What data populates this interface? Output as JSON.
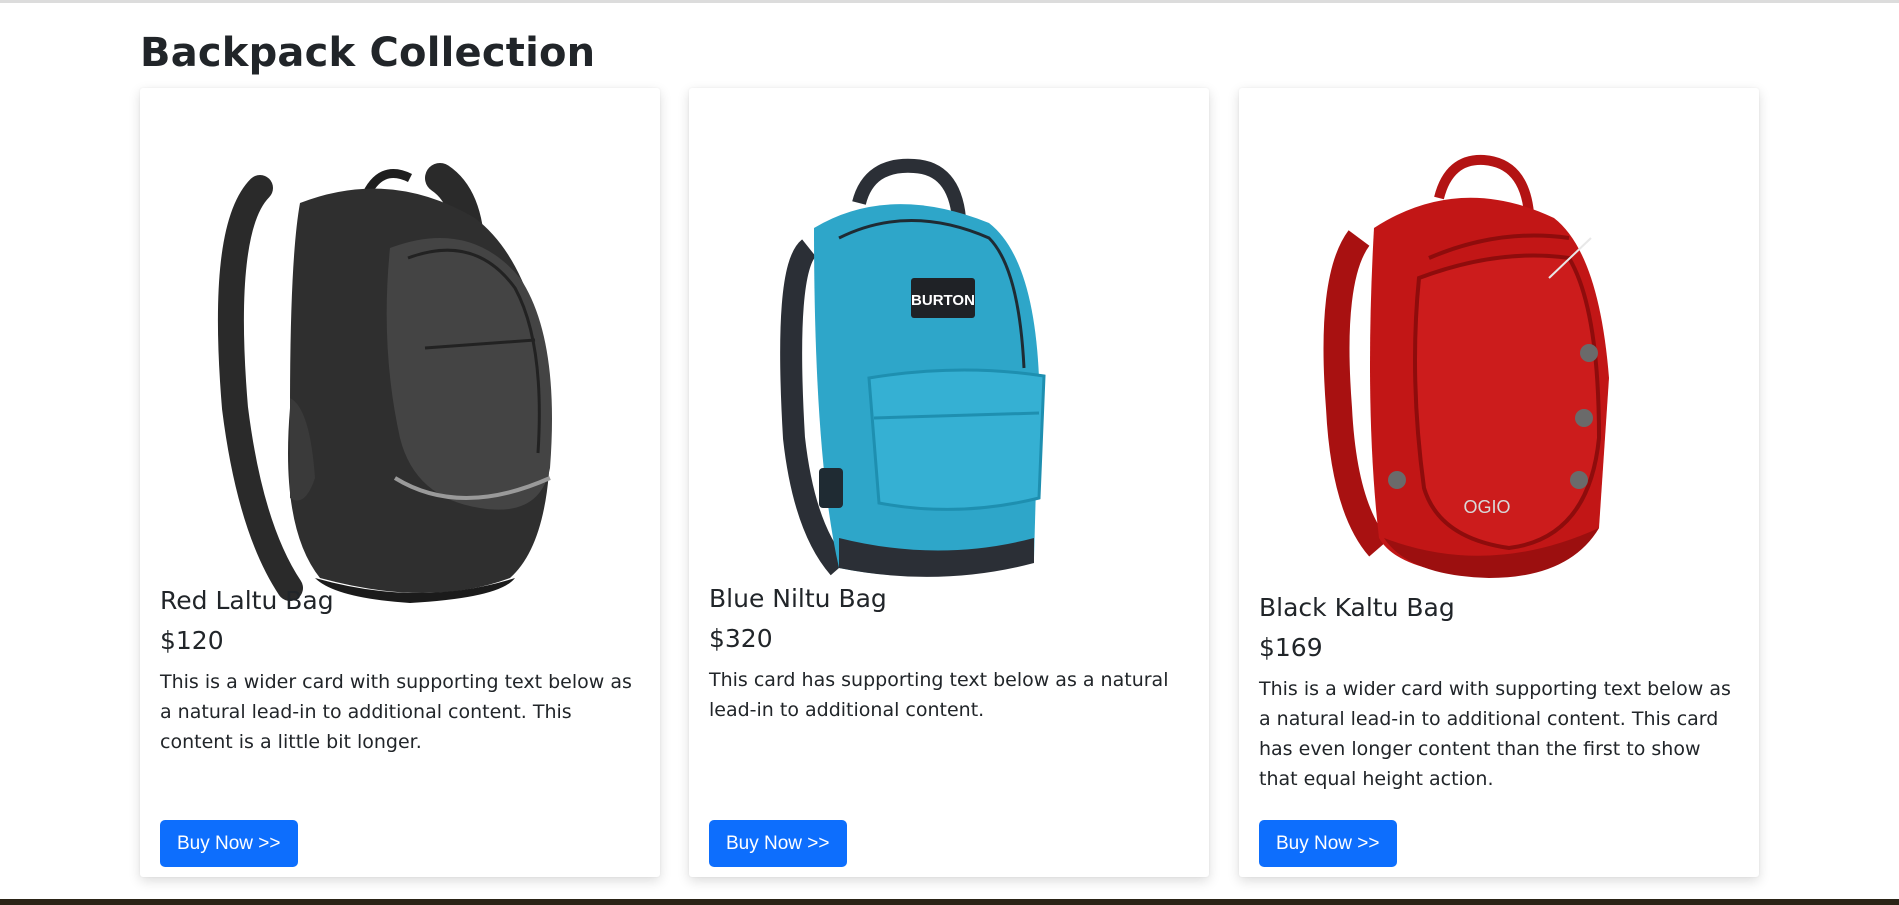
{
  "page": {
    "heading": "Backpack Collection"
  },
  "cards": [
    {
      "title": "Red Laltu Bag",
      "price": "$120",
      "text": "This is a wider card with supporting text below as a natural lead-in to additional content. This content is a little bit longer.",
      "button": "Buy Now >>",
      "image": "black-backpack-image"
    },
    {
      "title": "Blue Niltu Bag",
      "price": "$320",
      "text": "This card has supporting text below as a natural lead-in to additional content.",
      "button": "Buy Now >>",
      "image": "blue-backpack-image",
      "badge": "BURTON"
    },
    {
      "title": "Black Kaltu Bag",
      "price": "$169",
      "text": "This is a wider card with supporting text below as a natural lead-in to additional content. This card has even longer content than the first to show that equal height action.",
      "button": "Buy Now >>",
      "image": "red-backpack-image",
      "badge": "OGIO"
    }
  ],
  "colors": {
    "button": "#0d6efd",
    "text": "#212529"
  }
}
